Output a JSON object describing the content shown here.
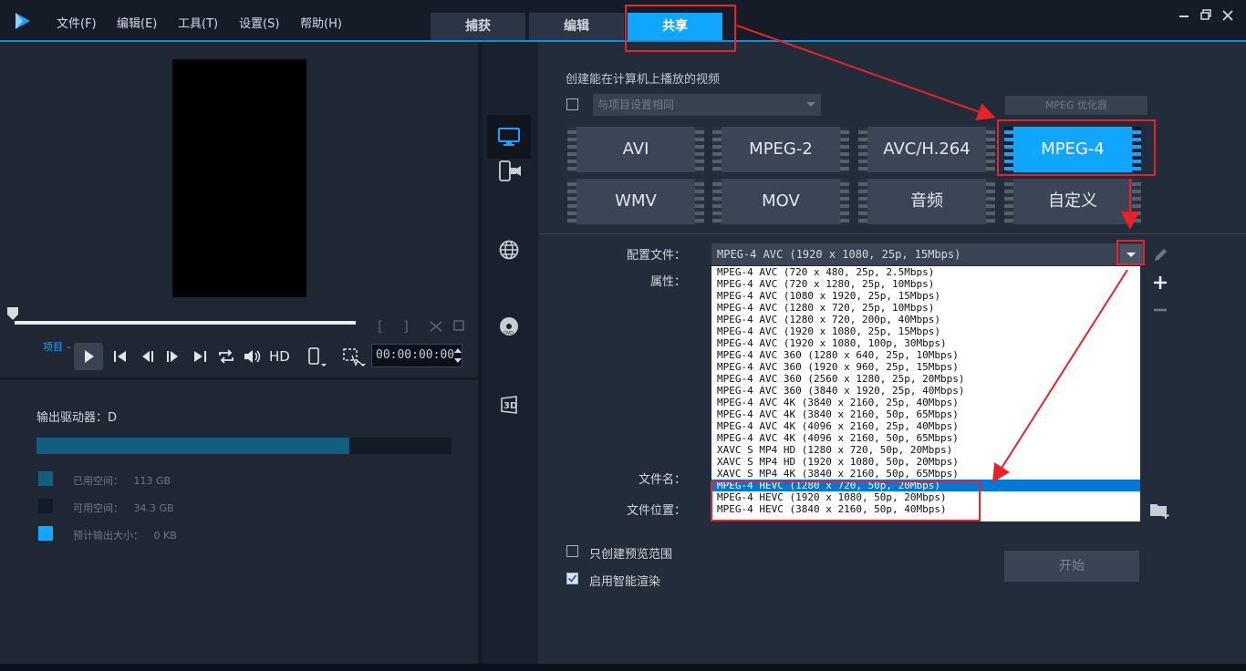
{
  "menu": {
    "items": [
      "文件(F)",
      "编辑(E)",
      "工具(T)",
      "设置(S)",
      "帮助(H)"
    ]
  },
  "tabs": {
    "capture": "捕获",
    "edit": "编辑",
    "share": "共享"
  },
  "player": {
    "project_label": "项目",
    "hd": "HD",
    "timecode": "00:00:00:00"
  },
  "drive": {
    "label": "输出驱动器：D",
    "used_fraction": 0.753,
    "legend": [
      {
        "label": "已用空间：",
        "value": "113 GB",
        "color": "#125d80"
      },
      {
        "label": "可用空间：",
        "value": "34.3 GB",
        "color": "#141b26"
      },
      {
        "label": "预计输出大小：",
        "value": "0 KB",
        "color": "#12a8ff"
      }
    ]
  },
  "share": {
    "title": "创建能在计算机上播放的视频",
    "same_settings": "与项目设置相同",
    "mpeg_optimizer": "MPEG 优化器",
    "formats": [
      "AVI",
      "MPEG-2",
      "AVC/H.264",
      "MPEG-4",
      "WMV",
      "MOV",
      "音频",
      "自定义"
    ],
    "active_format": "MPEG-4",
    "profile_label": "配置文件：",
    "attributes_label": "属性：",
    "filename_label": "文件名：",
    "location_label": "文件位置：",
    "profile_value": "MPEG-4 AVC (1920 x 1080, 25p, 15Mbps)",
    "profile_options": [
      "MPEG-4 AVC (720 x 480, 25p, 2.5Mbps)",
      "MPEG-4 AVC (720 x 1280, 25p, 10Mbps)",
      "MPEG-4 AVC (1080 x 1920, 25p, 15Mbps)",
      "MPEG-4 AVC (1280 x 720, 25p, 10Mbps)",
      "MPEG-4 AVC (1280 x 720, 200p, 40Mbps)",
      "MPEG-4 AVC (1920 x 1080, 25p, 15Mbps)",
      "MPEG-4 AVC (1920 x 1080, 100p, 30Mbps)",
      "MPEG-4 AVC 360 (1280 x 640, 25p, 10Mbps)",
      "MPEG-4 AVC 360 (1920 x 960, 25p, 15Mbps)",
      "MPEG-4 AVC 360 (2560 x 1280, 25p, 20Mbps)",
      "MPEG-4 AVC 360 (3840 x 1920, 25p, 40Mbps)",
      "MPEG-4 AVC 4K (3840 x 2160, 25p, 40Mbps)",
      "MPEG-4 AVC 4K (3840 x 2160, 50p, 65Mbps)",
      "MPEG-4 AVC 4K (4096 x 2160, 25p, 40Mbps)",
      "MPEG-4 AVC 4K (4096 x 2160, 50p, 65Mbps)",
      "XAVC S MP4 HD (1280 x 720, 50p, 20Mbps)",
      "XAVC S MP4 HD (1920 x 1080, 50p, 20Mbps)",
      "XAVC S MP4 4K (3840 x 2160, 50p, 65Mbps)",
      "MPEG-4 HEVC (1280 x 720, 50p, 20Mbps)",
      "MPEG-4 HEVC (1920 x 1080, 50p, 20Mbps)",
      "MPEG-4 HEVC (3840 x 2160, 50p, 40Mbps)"
    ],
    "selected_option_index": 18,
    "preview_only": "只创建预览范围",
    "smart_render": "启用智能渲染",
    "smart_render_checked": true,
    "preview_only_checked": false,
    "start": "开始"
  },
  "colors": {
    "accent": "#10a5ff",
    "annotation": "#e8222b",
    "dropdown_selection": "#0078d7"
  }
}
